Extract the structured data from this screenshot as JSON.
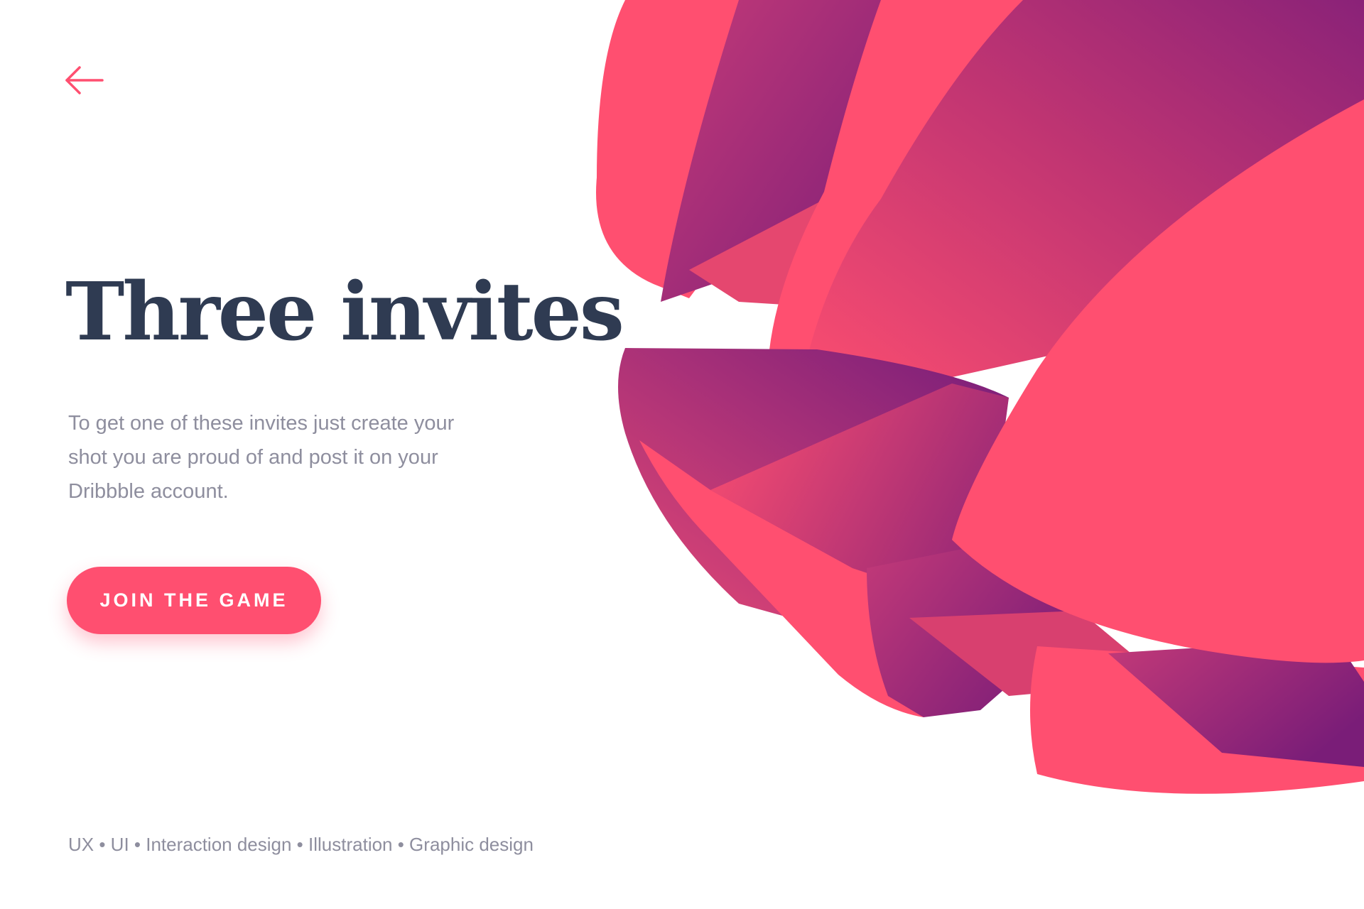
{
  "navigation": {
    "back_icon": "arrow-left-icon",
    "accent_color": "#ff4f70"
  },
  "hero": {
    "title": "Three invites",
    "description": "To get one of these invites just create your shot you are proud of and post it on your Dribbble account.",
    "cta_label": "JOIN THE GAME"
  },
  "footer": {
    "tags": "UX • UI • Interaction design • Illustration • Graphic design"
  },
  "illustration": {
    "name": "abstract-petal-sphere",
    "colors": {
      "pink": "#ff4f70",
      "purple": "#7c1f7a",
      "magenta": "#b93570"
    }
  },
  "colors": {
    "title": "#2f3b52",
    "body_text": "#8e8e9e",
    "background": "#ffffff"
  }
}
